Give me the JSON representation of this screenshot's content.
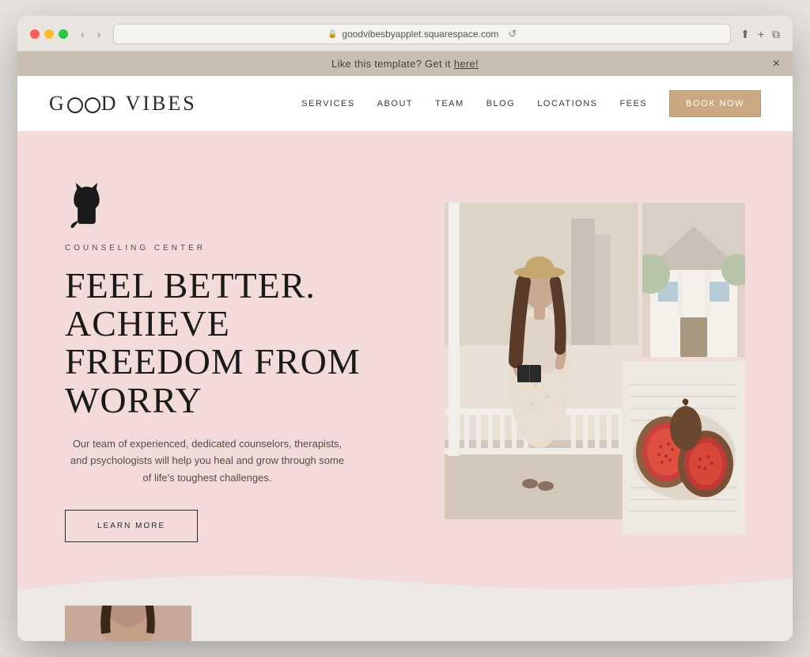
{
  "browser": {
    "url": "goodvibesbyapplet.squarespace.com",
    "reload_label": "↺",
    "back_label": "‹",
    "forward_label": "›"
  },
  "announcement": {
    "text": "Like this template? Get it here!",
    "close_label": "×"
  },
  "nav": {
    "logo": "GOOD VIBES",
    "links": [
      "SERVICES",
      "ABOUT",
      "TEAM",
      "BLOG",
      "LOCATIONS",
      "FEES"
    ],
    "cta": "BOOK NOW"
  },
  "hero": {
    "subtitle": "COUNSELING CENTER",
    "title_line1": "FEEL BETTER. ACHIEVE",
    "title_line2": "FREEDOM FROM WORRY",
    "description": "Our team of experienced, dedicated counselors, therapists, and psychologists will help you heal and grow through some of life's toughest challenges.",
    "cta": "LEARN MORE"
  },
  "colors": {
    "hero_bg": "#f2dbd8",
    "nav_bg": "#ffffff",
    "announcement_bg": "#c9bfb0",
    "book_btn_bg": "#c9a882",
    "book_btn_border": "#b89a7a"
  }
}
